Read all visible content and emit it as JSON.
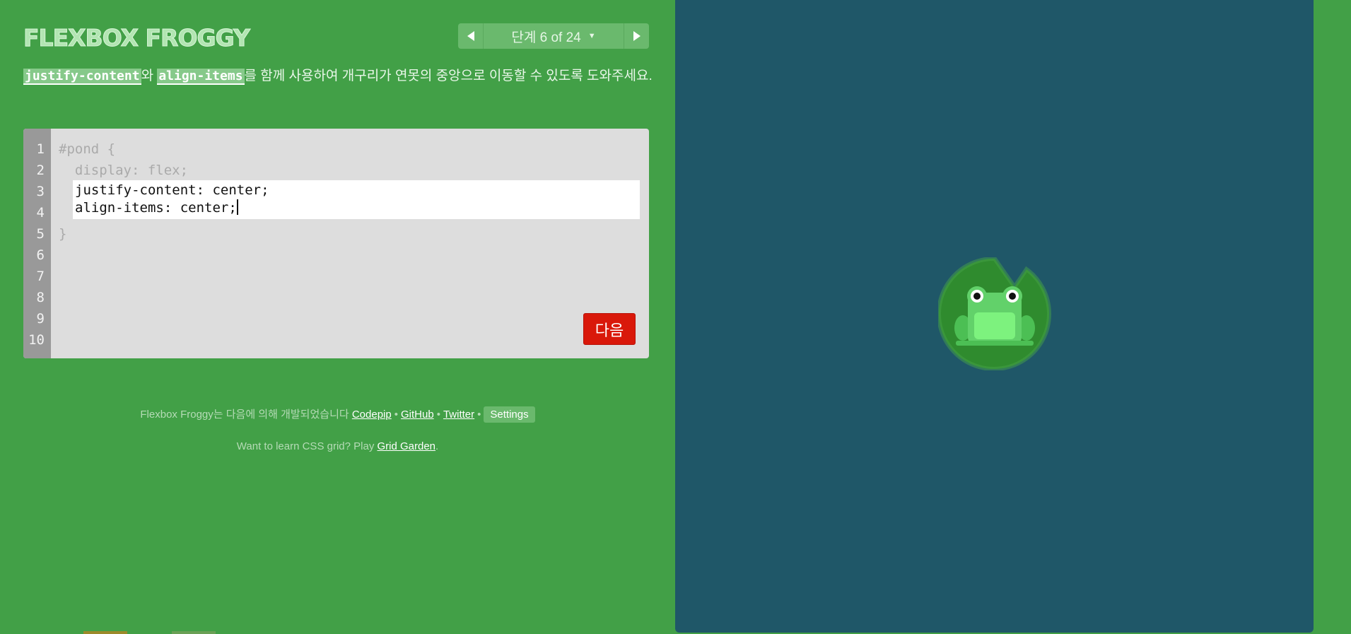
{
  "app": {
    "logo": "FLEXBOX FROGGY"
  },
  "level_nav": {
    "prev_icon": "triangle-left-icon",
    "label": "단계 6 of 24",
    "dropdown_icon": "caret-down-icon",
    "next_icon": "triangle-right-icon"
  },
  "instructions": {
    "prop1": "justify-content",
    "text1": "와 ",
    "prop2": "align-items",
    "text2": "를 함께 사용하여 개구리가 연못의 중앙으로 이동할 수 있도록 도와주세요."
  },
  "editor": {
    "line_numbers": [
      "1",
      "2",
      "3",
      "4",
      "5",
      "6",
      "7",
      "8",
      "9",
      "10"
    ],
    "line1": "#pond {",
    "line2": "  display: flex;",
    "input_line1": "justify-content: center;",
    "input_line2": "align-items: center;",
    "line5": "}",
    "next_button": "다음"
  },
  "footer": {
    "credit_text": "Flexbox Froggy는 다음에 의해 개발되었습니다 ",
    "codepip": "Codepip",
    "github": "GitHub",
    "twitter": "Twitter",
    "separator": "•",
    "settings": "Settings",
    "grid_text": "Want to learn CSS grid? Play ",
    "grid_link": "Grid Garden",
    "grid_end": "."
  },
  "pond": {
    "frog_color": "green",
    "lilypad_color": "green",
    "frog_icon": "frog-icon",
    "lilypad_icon": "lilypad-icon"
  },
  "colors": {
    "background": "#42a047",
    "pond": "#1f5768",
    "next_button": "#d9180a",
    "lilypad": "#2f8b2e",
    "frog": "#62d16a"
  }
}
